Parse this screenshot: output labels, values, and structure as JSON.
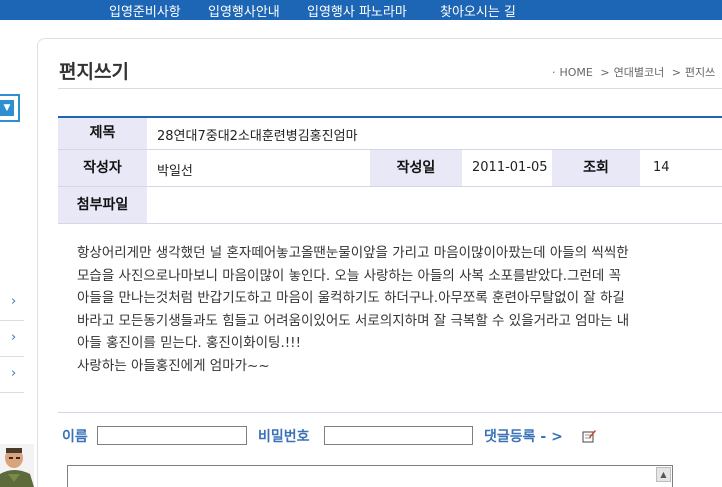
{
  "topnav": {
    "items": [
      "입영준비사항",
      "입영행사안내",
      "입영행사 파노라마",
      "찾아오시는 길"
    ]
  },
  "page": {
    "title": "편지쓰기",
    "breadcrumb": [
      "HOME",
      "연대별코너",
      "편지쓰"
    ]
  },
  "post": {
    "subject_label": "제목",
    "subject": "28연대7중대2소대훈련병김홍진엄마",
    "author_label": "작성자",
    "author": "박일선",
    "date_label": "작성일",
    "date": "2011-01-05",
    "views_label": "조회",
    "views": "14",
    "attachment_label": "첨부파일",
    "body_lines": [
      "항상어리게만 생각했던 널 혼자떼어놓고올땐눈물이앞을 가리고 마음이많이아팠는데 아들의 씩씩한",
      "모습을 사진으로나마보니 마음이많이 놓인다. 오늘 사랑하는 아들의 사복 소포를받았다.그런데 꼭",
      "아들을 만나는것처럼 반갑기도하고 마음이 울컥하기도 하더구나.아무쪼록 훈련아무탈없이 잘 하길",
      "바라고 모든동기생들과도 힘들고 어려움이있어도 서로의지하며 잘 극복할 수 있을거라고 엄마는 내",
      "아들 홍진이를 믿는다. 홍진이화이팅.!!!",
      "사랑하는 아들홍진에게 엄마가~~"
    ]
  },
  "comment": {
    "name_label": "이름",
    "name_value": "",
    "password_label": "비밀번호",
    "password_value": "",
    "submit_label": "댓글등록 - >"
  },
  "colors": {
    "nav_bg": "#1d66b5",
    "label_bg": "#e8e8f7",
    "accent": "#3a72b8"
  }
}
